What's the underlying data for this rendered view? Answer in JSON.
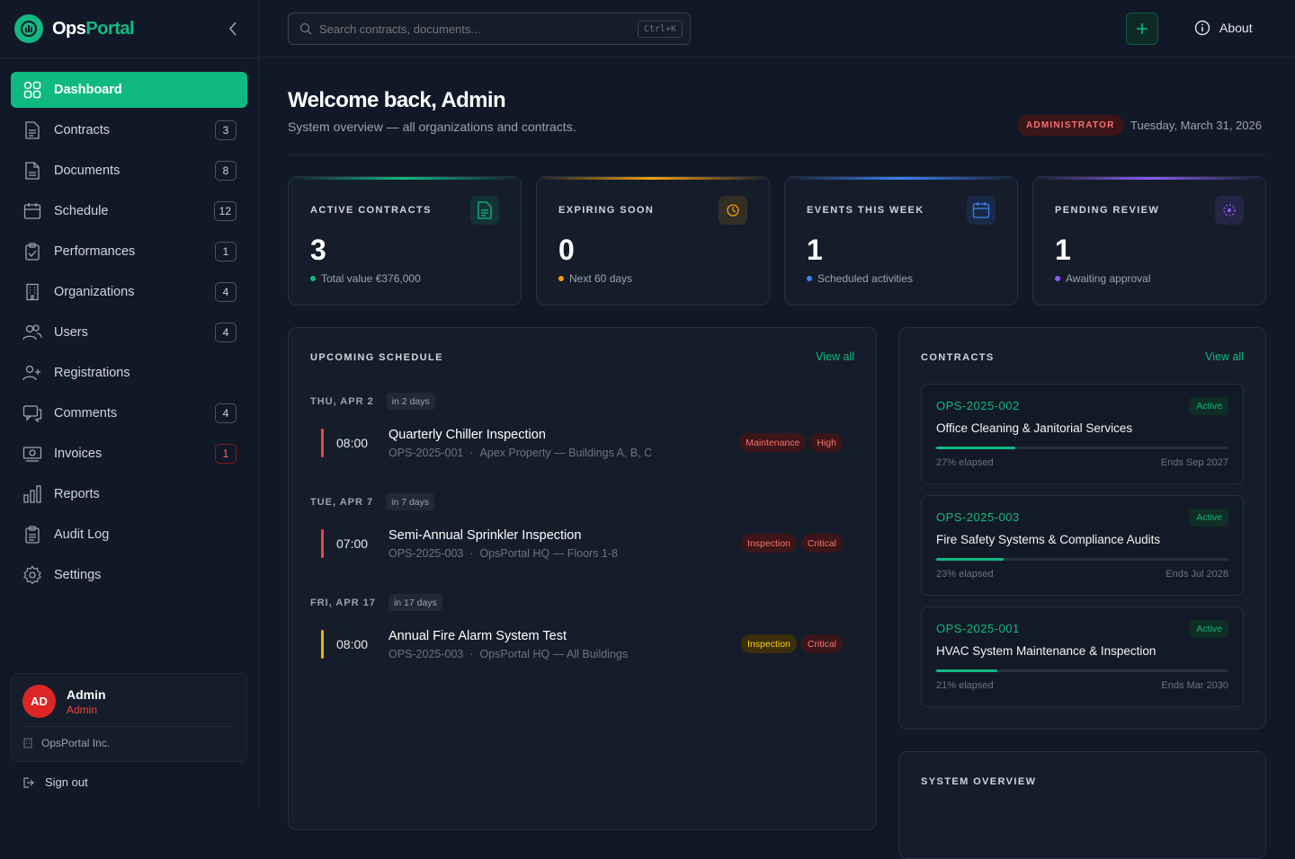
{
  "brand": {
    "name_a": "Ops",
    "name_b": "Portal"
  },
  "colors": {
    "accent": "#10b981",
    "background": "#111827",
    "danger": "#ef4444"
  },
  "sidebar": {
    "items": [
      {
        "label": "Dashboard",
        "icon": "dashboard-grid-icon",
        "badge": null,
        "active": true
      },
      {
        "label": "Contracts",
        "icon": "document-icon",
        "badge": "3"
      },
      {
        "label": "Documents",
        "icon": "file-icon",
        "badge": "8"
      },
      {
        "label": "Schedule",
        "icon": "calendar-icon",
        "badge": "12"
      },
      {
        "label": "Performances",
        "icon": "clipboard-check-icon",
        "badge": "1"
      },
      {
        "label": "Organizations",
        "icon": "building-icon",
        "badge": "4"
      },
      {
        "label": "Users",
        "icon": "users-icon",
        "badge": "4"
      },
      {
        "label": "Registrations",
        "icon": "user-plus-icon",
        "badge": null
      },
      {
        "label": "Comments",
        "icon": "comments-icon",
        "badge": "4"
      },
      {
        "label": "Invoices",
        "icon": "invoice-icon",
        "badge": "1"
      },
      {
        "label": "Reports",
        "icon": "bar-chart-icon",
        "badge": null
      },
      {
        "label": "Audit Log",
        "icon": "clipboard-list-icon",
        "badge": null
      },
      {
        "label": "Settings",
        "icon": "gear-icon",
        "badge": null
      }
    ],
    "user": {
      "initials": "AD",
      "name": "Admin",
      "role": "Admin",
      "org": "OpsPortal Inc."
    },
    "signout": "Sign out"
  },
  "topbar": {
    "search_placeholder": "Search contracts, documents...",
    "shortcut": "Ctrl+K",
    "about": "About"
  },
  "header": {
    "title": "Welcome back, Admin",
    "subtitle": "System overview — all organizations and contracts.",
    "role": "ADMINISTRATOR",
    "date": "Tuesday, March 31, 2026"
  },
  "stats": [
    {
      "label": "ACTIVE CONTRACTS",
      "value": "3",
      "sub": "Total value €376,000",
      "color": "#10b981",
      "icon": "document-icon"
    },
    {
      "label": "EXPIRING SOON",
      "value": "0",
      "sub": "Next 60 days",
      "color": "#f59e0b",
      "icon": "clock-icon"
    },
    {
      "label": "EVENTS THIS WEEK",
      "value": "1",
      "sub": "Scheduled activities",
      "color": "#3b82f6",
      "icon": "calendar-icon"
    },
    {
      "label": "PENDING REVIEW",
      "value": "1",
      "sub": "Awaiting approval",
      "color": "#8b5cf6",
      "icon": "pending-icon"
    }
  ],
  "schedule": {
    "title": "UPCOMING SCHEDULE",
    "view_all": "View all",
    "groups": [
      {
        "day": "THU, APR 2",
        "rel": "in 2 days",
        "event": {
          "time": "08:00",
          "title": "Quarterly Chiller Inspection",
          "contract": "OPS-2025-001",
          "location": "Apex Property — Buildings A, B, C",
          "color": "#ef4444",
          "tags": [
            {
              "text": "Maintenance",
              "kind": "red"
            },
            {
              "text": "High",
              "kind": "red"
            }
          ]
        }
      },
      {
        "day": "TUE, APR 7",
        "rel": "in 7 days",
        "event": {
          "time": "07:00",
          "title": "Semi-Annual Sprinkler Inspection",
          "contract": "OPS-2025-003",
          "location": "OpsPortal HQ — Floors 1-8",
          "color": "#ef4444",
          "tags": [
            {
              "text": "Inspection",
              "kind": "red"
            },
            {
              "text": "Critical",
              "kind": "red"
            }
          ]
        }
      },
      {
        "day": "FRI, APR 17",
        "rel": "in 17 days",
        "event": {
          "time": "08:00",
          "title": "Annual Fire Alarm System Test",
          "contract": "OPS-2025-003",
          "location": "OpsPortal HQ — All Buildings",
          "color": "#eab308",
          "tags": [
            {
              "text": "Inspection",
              "kind": "yellow"
            },
            {
              "text": "Critical",
              "kind": "red"
            }
          ]
        }
      }
    ]
  },
  "contracts": {
    "title": "CONTRACTS",
    "view_all": "View all",
    "items": [
      {
        "id": "OPS-2025-002",
        "status": "Active",
        "name": "Office Cleaning & Janitorial Services",
        "progress": 27,
        "elapsed": "27% elapsed",
        "ends": "Ends Sep 2027"
      },
      {
        "id": "OPS-2025-003",
        "status": "Active",
        "name": "Fire Safety Systems & Compliance Audits",
        "progress": 23,
        "elapsed": "23% elapsed",
        "ends": "Ends Jul 2028"
      },
      {
        "id": "OPS-2025-001",
        "status": "Active",
        "name": "HVAC System Maintenance & Inspection",
        "progress": 21,
        "elapsed": "21% elapsed",
        "ends": "Ends Mar 2030"
      }
    ]
  },
  "overview": {
    "title": "SYSTEM OVERVIEW"
  }
}
